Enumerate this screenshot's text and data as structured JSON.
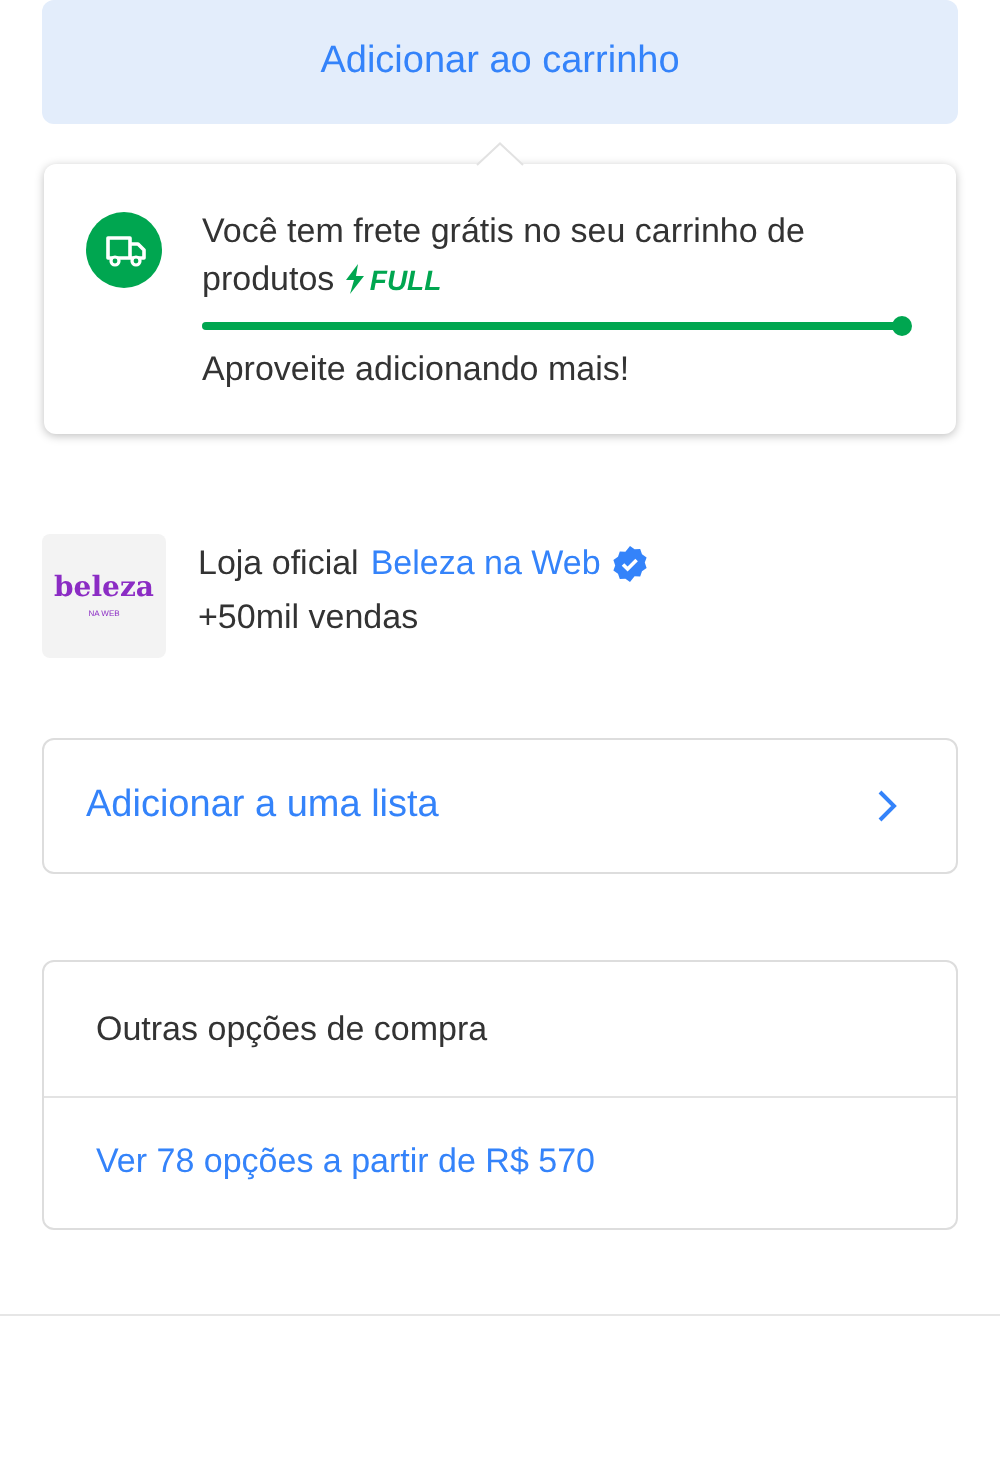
{
  "add_to_cart_button": "Adicionar ao carrinho",
  "shipping_popup": {
    "message": "Você tem frete grátis no seu carrinho de produtos",
    "badge": "FULL",
    "level": 1,
    "hint": "Aproveite adicionando mais!"
  },
  "seller": {
    "logo_text": "beleza",
    "logo_subtext": "NA WEB",
    "label": "Loja oficial",
    "name": "Beleza na Web",
    "verified": true,
    "sales": "+50mil vendas"
  },
  "add_to_list": {
    "label": "Adicionar a uma lista"
  },
  "other_options": {
    "title": "Outras opções de compra",
    "link": "Ver 78 opções a partir de R$ 570"
  }
}
